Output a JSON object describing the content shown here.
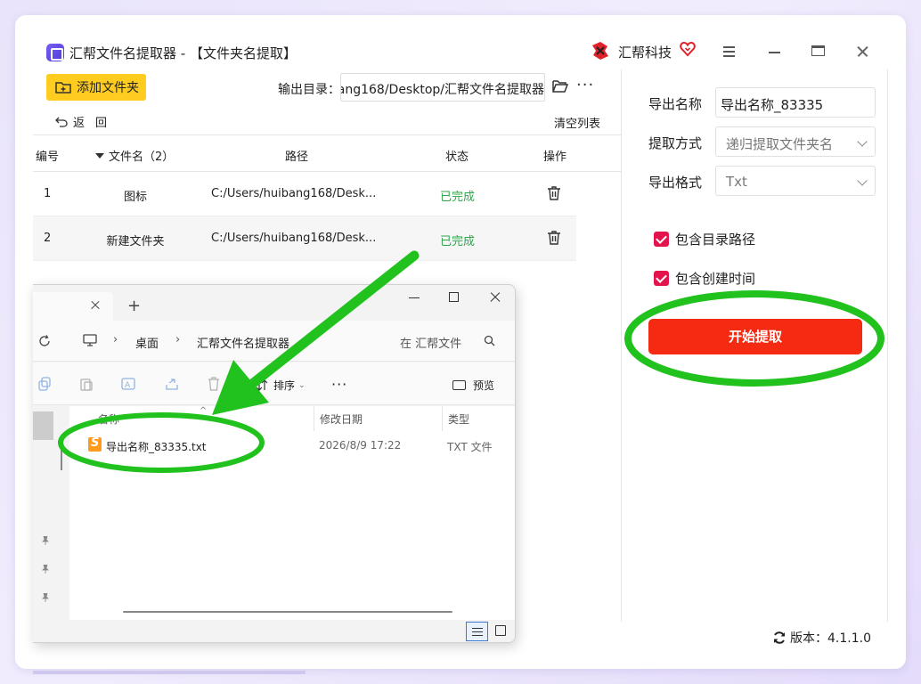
{
  "app": {
    "title": "汇帮文件名提取器 - 【文件夹名提取】",
    "brand": "汇帮科技",
    "version_label": "版本：4.1.1.0"
  },
  "toolbar": {
    "add_folder_label": "添加文件夹",
    "output_dir_label": "输出目录：",
    "output_dir_value": "ang168/Desktop/汇帮文件名提取器",
    "more_label": "···",
    "back_label": "返回",
    "clear_list_label": "清空列表"
  },
  "table": {
    "headers": {
      "no": "编号",
      "name": "文件名（2）",
      "path": "路径",
      "status": "状态",
      "action": "操作"
    },
    "rows": [
      {
        "no": "1",
        "name": "图标",
        "path": "C:/Users/huibang168/Desk...",
        "status": "已完成"
      },
      {
        "no": "2",
        "name": "新建文件夹",
        "path": "C:/Users/huibang168/Desk...",
        "status": "已完成"
      }
    ]
  },
  "settings": {
    "export_name_label": "导出名称",
    "export_name_value": "导出名称_83335",
    "extract_mode_label": "提取方式",
    "extract_mode_value": "递归提取文件夹名",
    "export_format_label": "导出格式",
    "export_format_value": "Txt",
    "include_path_label": "包含目录路径",
    "include_time_label": "包含创建时间",
    "start_label": "开始提取"
  },
  "explorer": {
    "new_tab_label": "+",
    "breadcrumbs": [
      "桌面",
      "汇帮文件名提取器"
    ],
    "search_placeholder": "在 汇帮文件",
    "sort_label": "排序",
    "more_label": "···",
    "preview_label": "预览",
    "columns": {
      "name": "名称",
      "date": "修改日期",
      "type": "类型"
    },
    "files": [
      {
        "name": "导出名称_83335.txt",
        "date": "2026/8/9 17:22",
        "type": "TXT 文件"
      }
    ]
  },
  "colors": {
    "accent_yellow": "#ffcc1f",
    "start_red": "#f52a12",
    "checkbox": "#e2134d",
    "done_green": "#2ea64a",
    "annotation_green": "#22c21e"
  }
}
